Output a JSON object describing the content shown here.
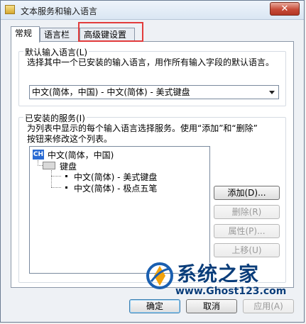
{
  "window": {
    "title": "文本服务和输入语言",
    "close_label": "✕"
  },
  "tabs": [
    {
      "label": "常规",
      "active": true
    },
    {
      "label": "语言栏",
      "active": false
    },
    {
      "label": "高级键设置",
      "active": false
    }
  ],
  "default_language": {
    "group_title": "默认输入语言(L)",
    "description": "选择其中一个已安装的输入语言，用作所有输入字段的默认语言。",
    "selected": "中文(简体，中国) - 中文(简体) - 美式键盘"
  },
  "installed_services": {
    "group_title": "已安装的服务(I)",
    "description_line1": "为列表中显示的每个输入语言选择服务。使用“添加”和“删除”",
    "description_line2": "按钮来修改这个列表。",
    "tree": {
      "language_badge": "CH",
      "language": "中文(简体，中国)",
      "category": "键盘",
      "items": [
        "中文(简体) - 美式键盘",
        "中文(简体) - 极点五笔"
      ]
    },
    "buttons": {
      "add": "添加(D)...",
      "remove": "删除(R)",
      "properties": "属性(P)...",
      "move_up": "上移(U)"
    }
  },
  "footer": {
    "ok": "确定",
    "cancel": "取消",
    "apply": "应用(A)"
  },
  "watermark": {
    "title": "系统之家",
    "url": "www.Ghost123.com"
  }
}
